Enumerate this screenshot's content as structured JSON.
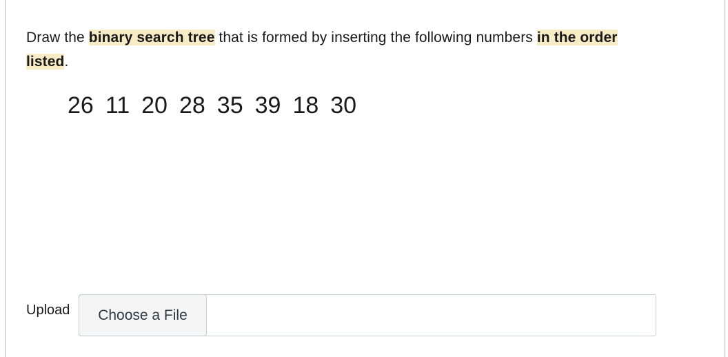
{
  "question": {
    "segments": [
      {
        "text": "Draw the ",
        "highlight": false
      },
      {
        "text": "binary search tree",
        "highlight": true
      },
      {
        "text": " that is formed by inserting the following numbers ",
        "highlight": false
      },
      {
        "text": "in the order listed",
        "highlight": true
      },
      {
        "text": ".",
        "highlight": false
      }
    ],
    "part1": "Draw the ",
    "emphasis1": "binary search tree",
    "part2": " that is formed by inserting the following numbers ",
    "emphasis2a": "in the order",
    "emphasis2b": "listed",
    "part3": "."
  },
  "numbers": [
    "26",
    "11",
    "20",
    "28",
    "35",
    "39",
    "18",
    "30"
  ],
  "upload": {
    "label": "Upload",
    "button_label": "Choose a File",
    "file_name": ""
  },
  "colors": {
    "highlight": "#f8ecc6",
    "text": "#1a1a1a",
    "button_bg": "#f5f5f5",
    "border": "#c7cdd1"
  }
}
